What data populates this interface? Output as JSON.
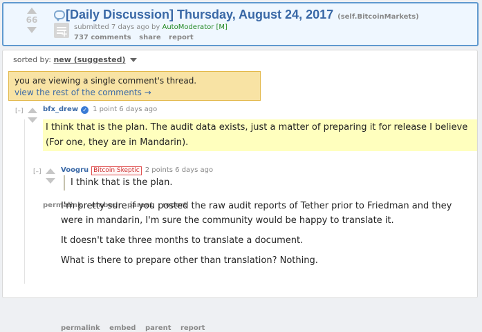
{
  "post": {
    "score": "66",
    "title": "[Daily Discussion] Thursday, August 24, 2017",
    "domain": "(self.BitcoinMarkets)",
    "submitted_prefix": "submitted 7 days ago by",
    "author": "AutoModerator",
    "mod_tag": "[M]",
    "comments_label": "737 comments",
    "share_label": "share",
    "report_label": "report"
  },
  "sort": {
    "prefix": "sorted by:",
    "value": "new (suggested)"
  },
  "notice": {
    "text": "you are viewing a single comment's thread.",
    "link": "view the rest of the comments →"
  },
  "comments": [
    {
      "expand": "[–]",
      "author": "bfx_drew",
      "verified": true,
      "meta": "1 point 6 days ago",
      "body": "I think that is the plan. The audit data exists, just a matter of preparing it for release I believe (For one, they are in Mandarin).",
      "buttons": [
        "permalink",
        "embed",
        "parent",
        "report"
      ]
    },
    {
      "expand": "[–]",
      "author": "Voogru",
      "flair": "Bitcoin Skeptic",
      "meta": "2 points 6 days ago",
      "quote": "I think that is the plan.",
      "paragraphs": [
        "I'm pretty sure if you posted the raw audit reports of Tether prior to Friedman and they were in mandarin, I'm sure the community would be happy to translate it.",
        "It doesn't take three months to translate a document.",
        "What is there to prepare other than translation? Nothing."
      ],
      "buttons": [
        "permalink",
        "embed",
        "parent",
        "report"
      ]
    }
  ]
}
